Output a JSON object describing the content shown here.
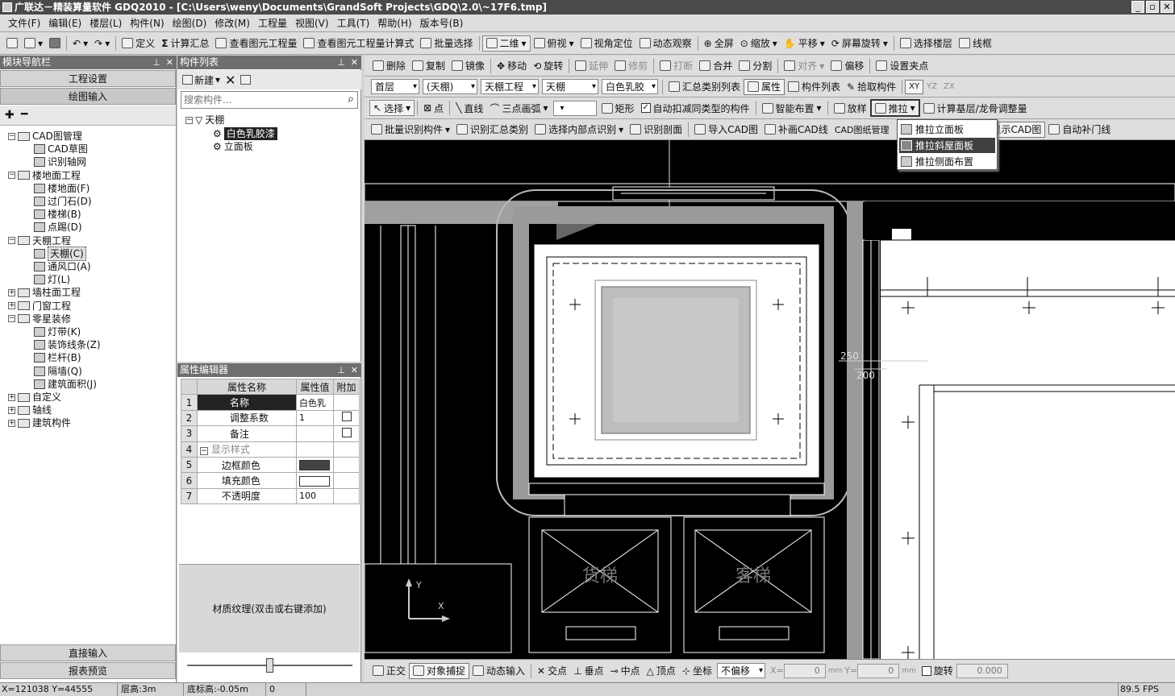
{
  "window": {
    "title": "广联达－精装算量软件 GDQ2010 - [C:\\Users\\weny\\Documents\\GrandSoft Projects\\GDQ\\2.0\\~17F6.tmp]",
    "controls": [
      "_",
      "▫",
      "✕"
    ]
  },
  "menu": [
    "文件(F)",
    "编辑(E)",
    "楼层(L)",
    "构件(N)",
    "绘图(D)",
    "修改(M)",
    "工程量",
    "视图(V)",
    "工具(T)",
    "帮助(H)",
    "版本号(B)"
  ],
  "toolbar1": {
    "define": "定义",
    "calc": "计算汇总",
    "view_qty": "查看图元工程量",
    "view_formula": "查看图元工程量计算式",
    "batch_select": "批量选择",
    "view_mode": "二维",
    "overlook": "俯视",
    "view_locate": "视角定位",
    "dynamic": "动态观察",
    "fullscreen": "全屏",
    "zoom": "缩放",
    "pan": "平移",
    "rotate_screen": "屏幕旋转",
    "select_floor": "选择楼层",
    "wireframe": "线框"
  },
  "nav": {
    "title": "模块导航栏",
    "tabs": [
      "工程设置",
      "绘图输入"
    ],
    "bottom_tabs": [
      "直接输入",
      "报表预览"
    ],
    "tree": [
      {
        "label": "CAD图管理",
        "level": 0,
        "toggle": "−"
      },
      {
        "label": "CAD草图",
        "level": 1
      },
      {
        "label": "识别轴网",
        "level": 1
      },
      {
        "label": "楼地面工程",
        "level": 0,
        "toggle": "−"
      },
      {
        "label": "楼地面(F)",
        "level": 1
      },
      {
        "label": "过门石(D)",
        "level": 1
      },
      {
        "label": "楼梯(B)",
        "level": 1
      },
      {
        "label": "点踢(D)",
        "level": 1
      },
      {
        "label": "天棚工程",
        "level": 0,
        "toggle": "−"
      },
      {
        "label": "天棚(C)",
        "level": 1,
        "selected": true
      },
      {
        "label": "通风口(A)",
        "level": 1
      },
      {
        "label": "灯(L)",
        "level": 1
      },
      {
        "label": "墙柱面工程",
        "level": 0,
        "toggle": "+"
      },
      {
        "label": "门窗工程",
        "level": 0,
        "toggle": "+"
      },
      {
        "label": "零星装修",
        "level": 0,
        "toggle": "−"
      },
      {
        "label": "灯带(K)",
        "level": 1
      },
      {
        "label": "装饰线条(Z)",
        "level": 1
      },
      {
        "label": "栏杆(B)",
        "level": 1
      },
      {
        "label": "隔墙(Q)",
        "level": 1
      },
      {
        "label": "建筑面积(J)",
        "level": 1
      },
      {
        "label": "自定义",
        "level": 0,
        "toggle": "+"
      },
      {
        "label": "轴线",
        "level": 0,
        "toggle": "+"
      },
      {
        "label": "建筑构件",
        "level": 0,
        "toggle": "+"
      }
    ]
  },
  "component_list": {
    "title": "构件列表",
    "new_label": "新建",
    "search_placeholder": "搜索构件...",
    "tree": [
      {
        "label": "天棚",
        "level": 0
      },
      {
        "label": "白色乳胶漆",
        "level": 1,
        "selected": true
      },
      {
        "label": "立面板",
        "level": 1
      }
    ]
  },
  "property_editor": {
    "title": "属性编辑器",
    "headers": [
      "属性名称",
      "属性值",
      "附加"
    ],
    "rows": [
      {
        "n": "1",
        "name": "名称",
        "value": "白色乳",
        "extra": ""
      },
      {
        "n": "2",
        "name": "调整系数",
        "value": "1",
        "extra": "checkbox"
      },
      {
        "n": "3",
        "name": "备注",
        "value": "",
        "extra": "checkbox"
      },
      {
        "n": "4",
        "name": "显示样式",
        "value": "",
        "extra": "",
        "group": true
      },
      {
        "n": "5",
        "name": "边框颜色",
        "value": "",
        "extra": "",
        "swatch": "#444444"
      },
      {
        "n": "6",
        "name": "填充颜色",
        "value": "",
        "extra": "",
        "swatch": "#ffffff"
      },
      {
        "n": "7",
        "name": "不透明度",
        "value": "100",
        "extra": ""
      }
    ],
    "texture_hint": "材质纹理(双击或右键添加)"
  },
  "toolbar2": [
    "删除",
    "复制",
    "镜像",
    "移动",
    "旋转",
    "延伸",
    "修剪",
    "打断",
    "合并",
    "分割",
    "对齐",
    "偏移",
    "设置夹点"
  ],
  "toolbar3": {
    "floor": "首层",
    "type": "(天棚)",
    "project": "天棚工程",
    "category": "天棚",
    "component": "白色乳胶",
    "summary_list": "汇总类别列表",
    "property": "属性",
    "comp_list": "构件列表",
    "pick": "拾取构件",
    "axes": [
      "XY",
      "YZ",
      "ZX"
    ]
  },
  "toolbar4": {
    "select": "选择",
    "point": "点",
    "line": "直线",
    "arc3": "三点画弧",
    "rect": "矩形",
    "auto_deduct": "自动扣减同类型的构件",
    "smart_layout": "智能布置",
    "place": "放样",
    "push": "推拉",
    "calc_base": "计算基层/龙骨调整量"
  },
  "toolbar5": {
    "batch_identify": "批量识别构件",
    "identify_summary": "识别汇总类别",
    "select_inner": "选择内部点识别",
    "identify_section": "识别剖面",
    "import_cad": "导入CAD图",
    "patch_cad": "补画CAD线",
    "cad_manage": "CAD图纸管理",
    "show_cad": "显示CAD图",
    "auto_door": "自动补门线"
  },
  "dropdown_menu": [
    "推拉立面板",
    "推拉斜屋面板",
    "推拉侧面布置"
  ],
  "cad": {
    "dim_250": "250",
    "dim_200": "200",
    "elevator1": "货梯",
    "elevator2": "客梯",
    "axis_y": "Y",
    "axis_x": "X"
  },
  "snapbar": {
    "ortho": "正交",
    "snap": "对象捕捉",
    "dynamic_input": "动态输入",
    "intersect": "交点",
    "perpendicular": "垂点",
    "midpoint": "中点",
    "vertex": "顶点",
    "coordinate": "坐标",
    "offset_mode": "不偏移",
    "x_label": "X=",
    "x_value": "0",
    "y_label": "Y=",
    "y_value": "0",
    "unit": "mm",
    "rotate": "旋转",
    "rotate_value": "0.000"
  },
  "status": {
    "coords": "X=121038 Y=44555",
    "floor_height": "层高:3m",
    "base_height": "底标高:-0.05m",
    "value": "0",
    "fps": "89.5 FPS"
  }
}
